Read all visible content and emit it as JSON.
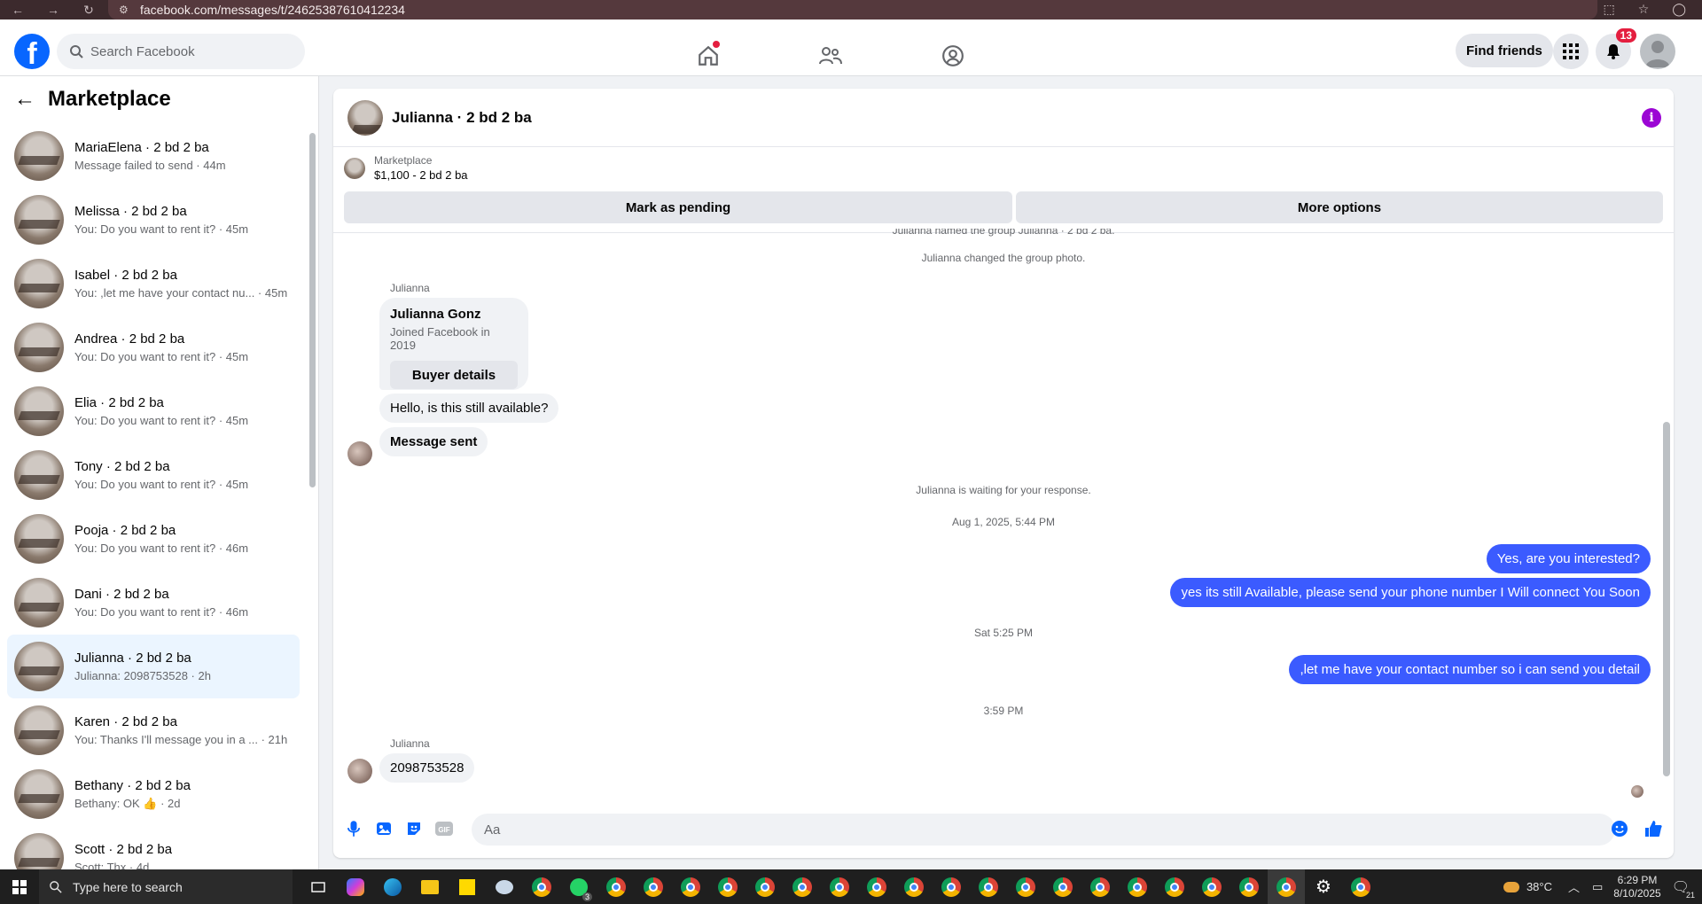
{
  "browser": {
    "url": "facebook.com/messages/t/24625387610412234"
  },
  "header": {
    "search_placeholder": "Search Facebook",
    "find_friends": "Find friends",
    "notification_count": "13"
  },
  "sidebar": {
    "title": "Marketplace",
    "conversations": [
      {
        "name": "MariaElena · 2 bd 2 ba",
        "preview": "Message failed to send · 44m",
        "active": false
      },
      {
        "name": "Melissa · 2 bd 2 ba",
        "preview": "You: Do you want to rent it? · 45m",
        "active": false
      },
      {
        "name": "Isabel · 2 bd 2 ba",
        "preview": "You: ,let me have your contact nu... · 45m",
        "active": false
      },
      {
        "name": "Andrea · 2 bd 2 ba",
        "preview": "You: Do you want to rent it? · 45m",
        "active": false
      },
      {
        "name": "Elia · 2 bd 2 ba",
        "preview": "You: Do you want to rent it? · 45m",
        "active": false
      },
      {
        "name": "Tony · 2 bd 2 ba",
        "preview": "You: Do you want to rent it? · 45m",
        "active": false
      },
      {
        "name": "Pooja · 2 bd 2 ba",
        "preview": "You: Do you want to rent it? · 46m",
        "active": false
      },
      {
        "name": "Dani · 2 bd 2 ba",
        "preview": "You: Do you want to rent it? · 46m",
        "active": false
      },
      {
        "name": "Julianna · 2 bd 2 ba",
        "preview": "Julianna: 2098753528 · 2h",
        "active": true
      },
      {
        "name": "Karen · 2 bd 2 ba",
        "preview": "You: Thanks I'll message you in a ... · 21h",
        "active": false
      },
      {
        "name": "Bethany · 2 bd 2 ba",
        "preview": "Bethany: OK 👍 · 2d",
        "active": false
      },
      {
        "name": "Scott · 2 bd 2 ba",
        "preview": "Scott: Thx · 4d",
        "active": false
      }
    ]
  },
  "chat": {
    "title": "Julianna · 2 bd 2 ba",
    "listing_category": "Marketplace",
    "listing_price": "$1,100 - 2 bd 2 ba",
    "mark_pending": "Mark as pending",
    "more_options": "More options",
    "sys_named": "Julianna named the group Julianna · 2 bd 2 ba.",
    "sys_photo": "Julianna changed the group photo.",
    "sender": "Julianna",
    "card_name": "Julianna Gonz",
    "card_joined": "Joined Facebook in 2019",
    "card_button": "Buyer details",
    "msg_available": "Hello, is this still available?",
    "msg_sent": "Message sent",
    "sys_waiting": "Julianna is waiting for your response.",
    "ts1": "Aug 1, 2025, 5:44 PM",
    "out1": "Yes, are you interested?",
    "out2": "yes its still Available, please send your phone number I Will connect You Soon",
    "ts2": "Sat 5:25 PM",
    "out3": ",let me have your contact number so i can send you detail",
    "ts3": "3:59 PM",
    "sender2": "Julianna",
    "msg_number": "2098753528",
    "composer_placeholder": "Aa",
    "gif_label": "GIF"
  },
  "taskbar": {
    "search_placeholder": "Type here to search",
    "temperature": "38°C",
    "time": "6:29 PM",
    "date": "8/10/2025",
    "notif_count": "21",
    "whatsapp_badge": "3"
  },
  "colors": {
    "brand_blue": "#0866ff",
    "outgoing_bubble": "#3b5bff",
    "active_conv": "#ebf5ff",
    "info_icon": "#9b06d4"
  }
}
